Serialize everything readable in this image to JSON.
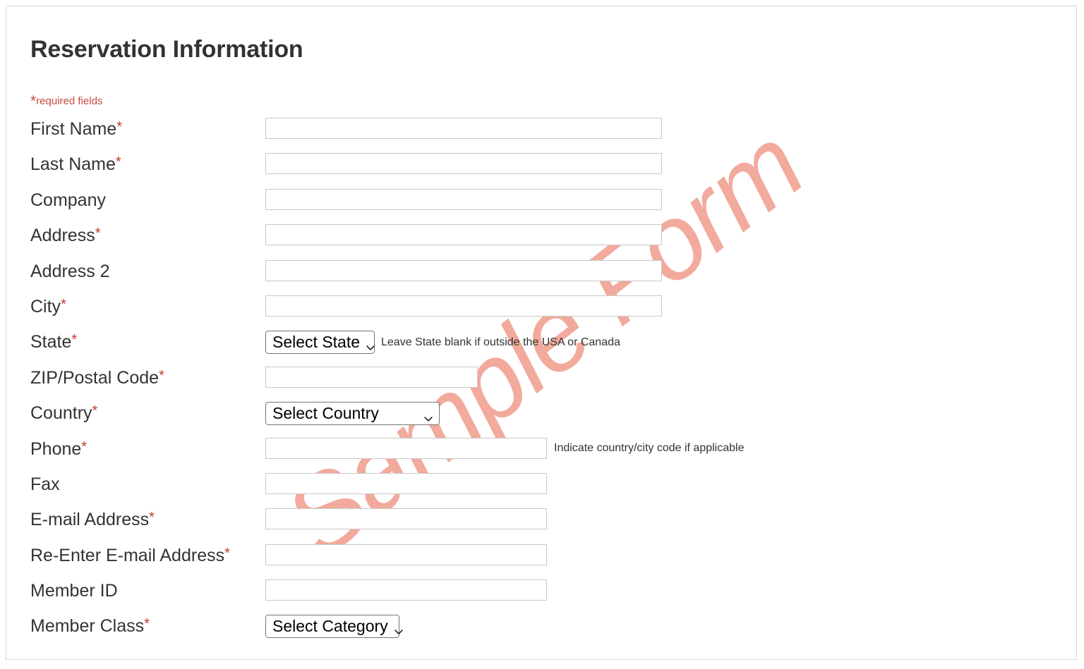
{
  "page": {
    "title": "Reservation Information",
    "required_note_star": "*",
    "required_note_text": "required fields",
    "watermark": "Sample Form",
    "watermark_color": "#f2aa9c",
    "required_color": "#c0392b",
    "note_color": "#c9493c",
    "title_color": "#333333"
  },
  "form": {
    "rows": [
      {
        "label": "First Name",
        "required": "*",
        "control": "text",
        "width": "wide",
        "value": "",
        "placeholder": "",
        "helper": ""
      },
      {
        "label": "Last Name",
        "required": "*",
        "control": "text",
        "width": "wide",
        "value": "",
        "placeholder": "",
        "helper": ""
      },
      {
        "label": "Company",
        "required": "",
        "control": "text",
        "width": "wide",
        "value": "",
        "placeholder": "",
        "helper": ""
      },
      {
        "label": "Address",
        "required": "*",
        "control": "text",
        "width": "wide",
        "value": "",
        "placeholder": "",
        "helper": ""
      },
      {
        "label": "Address 2",
        "required": "",
        "control": "text",
        "width": "wide",
        "value": "",
        "placeholder": "",
        "helper": ""
      },
      {
        "label": "City",
        "required": "*",
        "control": "text",
        "width": "wide",
        "value": "",
        "placeholder": "",
        "helper": ""
      },
      {
        "label": "State",
        "required": "*",
        "control": "select",
        "width": "state",
        "value": "Select State",
        "placeholder": "",
        "helper": "Leave State blank if outside the USA or Canada"
      },
      {
        "label": "ZIP/Postal Code",
        "required": "*",
        "control": "text",
        "width": "zip",
        "value": "",
        "placeholder": "",
        "helper": ""
      },
      {
        "label": "Country",
        "required": "*",
        "control": "select",
        "width": "country",
        "value": "Select Country",
        "placeholder": "",
        "helper": ""
      },
      {
        "label": "Phone",
        "required": "*",
        "control": "text",
        "width": "medium",
        "value": "",
        "placeholder": "",
        "helper": "Indicate country/city code if applicable"
      },
      {
        "label": "Fax",
        "required": "",
        "control": "text",
        "width": "medium",
        "value": "",
        "placeholder": "",
        "helper": ""
      },
      {
        "label": "E-mail Address",
        "required": "*",
        "control": "text",
        "width": "medium",
        "value": "",
        "placeholder": "",
        "helper": ""
      },
      {
        "label": "Re-Enter E-mail Address",
        "required": "*",
        "control": "text",
        "width": "medium",
        "value": "",
        "placeholder": "",
        "helper": ""
      },
      {
        "label": "Member ID",
        "required": "",
        "control": "text",
        "width": "medium",
        "value": "",
        "placeholder": "",
        "helper": ""
      },
      {
        "label": "Member Class",
        "required": "*",
        "control": "select",
        "width": "category",
        "value": "Select Category",
        "placeholder": "",
        "helper": ""
      }
    ]
  }
}
